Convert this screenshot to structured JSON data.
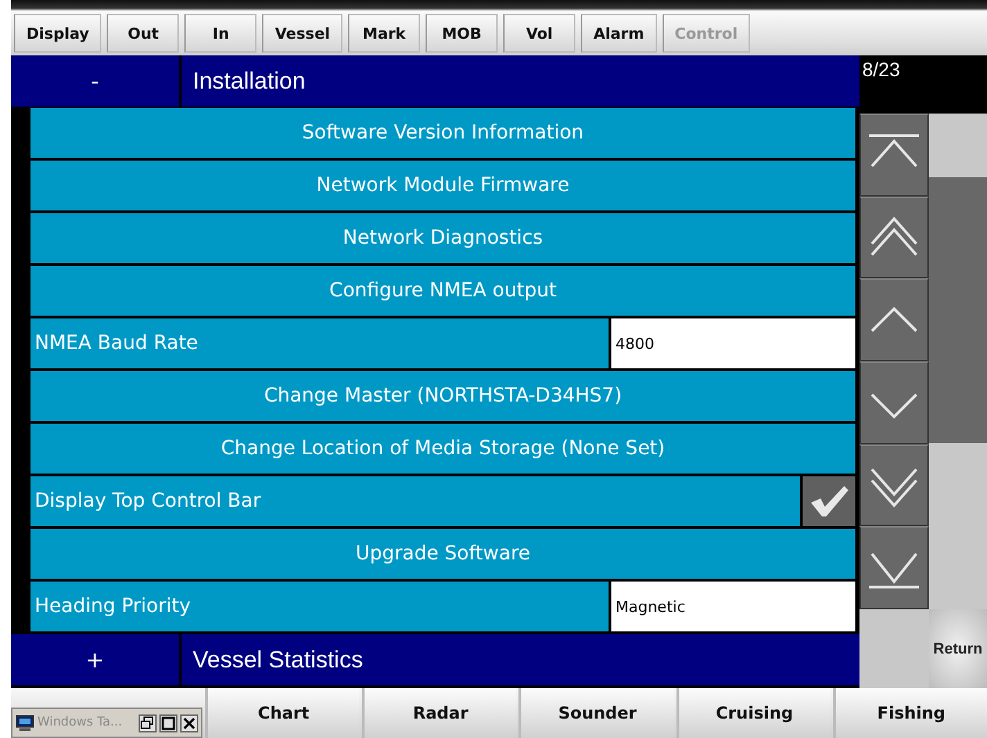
{
  "top_tabs": [
    {
      "label": "Display",
      "disabled": false
    },
    {
      "label": "Out",
      "disabled": false
    },
    {
      "label": "In",
      "disabled": false
    },
    {
      "label": "Vessel",
      "disabled": false
    },
    {
      "label": "Mark",
      "disabled": false
    },
    {
      "label": "MOB",
      "disabled": false
    },
    {
      "label": "Vol",
      "disabled": false
    },
    {
      "label": "Alarm",
      "disabled": false
    },
    {
      "label": "Control",
      "disabled": true
    }
  ],
  "sections": [
    {
      "sign": "-",
      "title": "Installation",
      "expanded": true,
      "rows": [
        {
          "kind": "action",
          "label": "Software Version Information"
        },
        {
          "kind": "action",
          "label": "Network Module Firmware"
        },
        {
          "kind": "action",
          "label": "Network Diagnostics"
        },
        {
          "kind": "action",
          "label": "Configure NMEA output"
        },
        {
          "kind": "value",
          "label": "NMEA Baud Rate",
          "value": "4800"
        },
        {
          "kind": "action",
          "label": "Change Master (NORTHSTA-D34HS7)"
        },
        {
          "kind": "action",
          "label": "Change Location of Media Storage (None Set)"
        },
        {
          "kind": "toggle",
          "label": "Display Top Control Bar",
          "checked": true
        },
        {
          "kind": "action",
          "label": "Upgrade Software"
        },
        {
          "kind": "value",
          "label": "Heading Priority",
          "value": "Magnetic"
        }
      ]
    },
    {
      "sign": "+",
      "title": "Vessel Statistics",
      "expanded": false
    }
  ],
  "page_count": "8/23",
  "scroll_buttons": [
    {
      "kind": "top"
    },
    {
      "kind": "page-up"
    },
    {
      "kind": "up"
    },
    {
      "kind": "down"
    },
    {
      "kind": "page-down"
    },
    {
      "kind": "bottom"
    }
  ],
  "return_button": "Return",
  "taskbar_widget": {
    "title": "Windows Ta..."
  },
  "bottom_tabs": [
    "Chart",
    "Radar",
    "Sounder",
    "Cruising",
    "Fishing"
  ]
}
